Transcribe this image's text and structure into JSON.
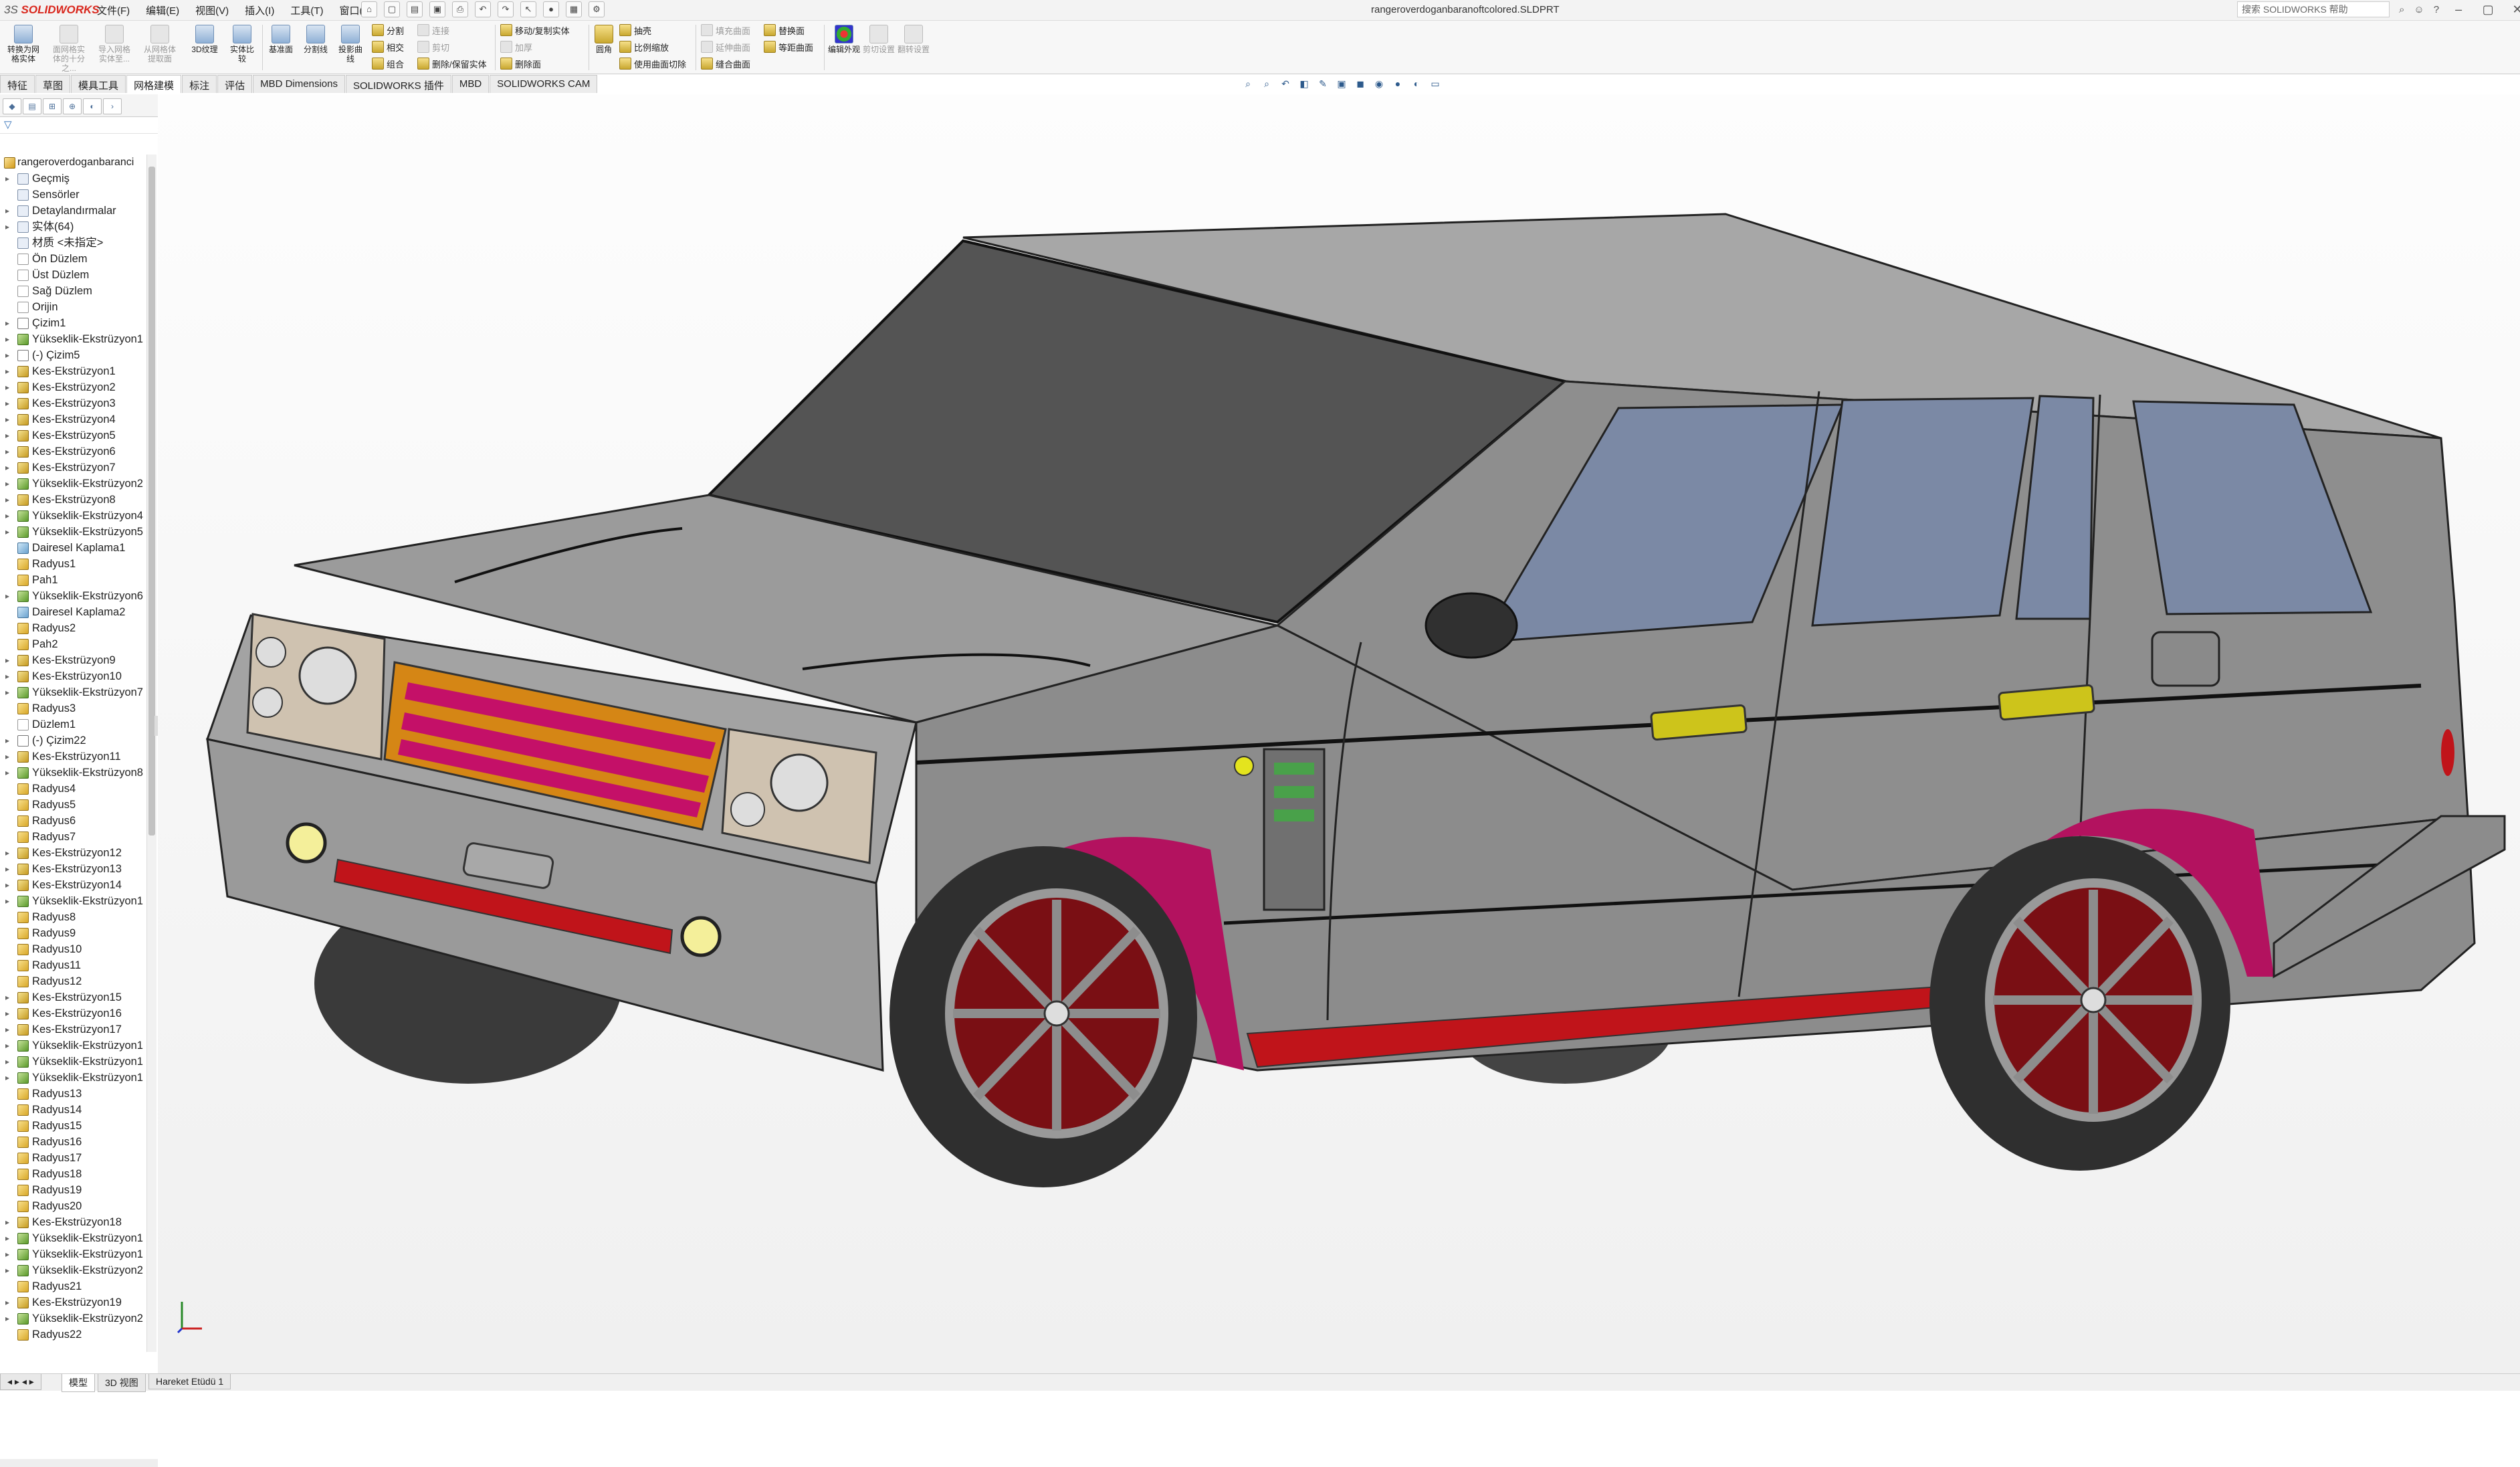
{
  "app": {
    "logo": "SOLIDWORKS",
    "logo_prefix": "3S",
    "document_title": "rangeroverdoganbaranoftcolored.SLDPRT"
  },
  "menu": [
    "文件(F)",
    "编辑(E)",
    "视图(V)",
    "插入(I)",
    "工具(T)",
    "窗口(W)"
  ],
  "help": {
    "search_placeholder": "搜索 SOLIDWORKS 帮助"
  },
  "ribbon": {
    "big": [
      {
        "label": "转换为网格实体",
        "enabled": true
      },
      {
        "label": "面网格实体的十分之...",
        "enabled": false
      },
      {
        "label": "导入网格实体至...",
        "enabled": false
      },
      {
        "label": "从网格体提取面",
        "enabled": false
      },
      {
        "label": "3D纹理",
        "enabled": true
      },
      {
        "label": "实体比较",
        "enabled": true
      },
      {
        "label": "基准面",
        "enabled": true
      },
      {
        "label": "分割线",
        "enabled": true
      },
      {
        "label": "投影曲线",
        "enabled": true
      }
    ],
    "small_a": [
      {
        "label": "分割",
        "enabled": true
      },
      {
        "label": "相交",
        "enabled": true
      },
      {
        "label": "组合",
        "enabled": true
      },
      {
        "label": "连接",
        "enabled": false
      },
      {
        "label": "剪切",
        "enabled": false
      },
      {
        "label": "删除/保留实体",
        "enabled": true
      }
    ],
    "small_b": [
      {
        "label": "移动/复制实体",
        "enabled": true
      },
      {
        "label": "加厚",
        "enabled": false
      },
      {
        "label": "删除面",
        "enabled": true
      }
    ],
    "fillet_label": "圆角",
    "small_c": [
      {
        "label": "抽壳",
        "enabled": true
      },
      {
        "label": "比例缩放",
        "enabled": true
      },
      {
        "label": "使用曲面切除",
        "enabled": true
      }
    ],
    "small_d": [
      {
        "label": "填充曲面",
        "enabled": false
      },
      {
        "label": "延伸曲面",
        "enabled": false
      },
      {
        "label": "缝合曲面",
        "enabled": true
      }
    ],
    "small_e": [
      {
        "label": "替换面",
        "enabled": true
      },
      {
        "label": "等距曲面",
        "enabled": true
      }
    ],
    "big_tail": [
      {
        "label": "编辑外观",
        "enabled": true
      },
      {
        "label": "剪切设置",
        "enabled": false
      },
      {
        "label": "翻转设置",
        "enabled": false
      }
    ]
  },
  "tabs": [
    "特征",
    "草图",
    "模具工具",
    "网格建模",
    "标注",
    "评估",
    "MBD Dimensions",
    "SOLIDWORKS 插件",
    "MBD",
    "SOLIDWORKS CAM"
  ],
  "active_tab": "网格建模",
  "tree": {
    "root": "rangeroverdoganbaranci",
    "items": [
      {
        "label": "Geçmiş",
        "icon": "history-icon",
        "arrow": true
      },
      {
        "label": "Sensörler",
        "icon": "sensor-icon",
        "arrow": false
      },
      {
        "label": "Detaylandırmalar",
        "icon": "annotation-icon",
        "arrow": true
      },
      {
        "label": "实体(64)",
        "icon": "solid-bodies-icon",
        "arrow": true
      },
      {
        "label": "材质 <未指定>",
        "icon": "material-icon",
        "arrow": false
      },
      {
        "label": "Ön Düzlem",
        "icon": "plane-icon",
        "arrow": false
      },
      {
        "label": "Üst Düzlem",
        "icon": "plane-icon",
        "arrow": false
      },
      {
        "label": "Sağ Düzlem",
        "icon": "plane-icon",
        "arrow": false
      },
      {
        "label": "Orijin",
        "icon": "origin-icon",
        "arrow": false
      },
      {
        "label": "Çizim1",
        "icon": "sketch-icon",
        "arrow": true
      },
      {
        "label": "Yükseklik-Ekstrüzyon1",
        "icon": "extrude-icon",
        "arrow": true
      },
      {
        "label": "(-) Çizim5",
        "icon": "sketch-icon",
        "arrow": true
      },
      {
        "label": "Kes-Ekstrüzyon1",
        "icon": "cut-icon",
        "arrow": true
      },
      {
        "label": "Kes-Ekstrüzyon2",
        "icon": "cut-icon",
        "arrow": true
      },
      {
        "label": "Kes-Ekstrüzyon3",
        "icon": "cut-icon",
        "arrow": true
      },
      {
        "label": "Kes-Ekstrüzyon4",
        "icon": "cut-icon",
        "arrow": true
      },
      {
        "label": "Kes-Ekstrüzyon5",
        "icon": "cut-icon",
        "arrow": true
      },
      {
        "label": "Kes-Ekstrüzyon6",
        "icon": "cut-icon",
        "arrow": true
      },
      {
        "label": "Kes-Ekstrüzyon7",
        "icon": "cut-icon",
        "arrow": true
      },
      {
        "label": "Yükseklik-Ekstrüzyon2",
        "icon": "extrude-icon",
        "arrow": true
      },
      {
        "label": "Kes-Ekstrüzyon8",
        "icon": "cut-icon",
        "arrow": true
      },
      {
        "label": "Yükseklik-Ekstrüzyon4",
        "icon": "extrude-icon",
        "arrow": true
      },
      {
        "label": "Yükseklik-Ekstrüzyon5",
        "icon": "extrude-icon",
        "arrow": true
      },
      {
        "label": "Dairesel Kaplama1",
        "icon": "pattern-icon",
        "arrow": false
      },
      {
        "label": "Radyus1",
        "icon": "fillet-icon",
        "arrow": false
      },
      {
        "label": "Pah1",
        "icon": "chamfer-icon",
        "arrow": false
      },
      {
        "label": "Yükseklik-Ekstrüzyon6",
        "icon": "extrude-icon",
        "arrow": true
      },
      {
        "label": "Dairesel Kaplama2",
        "icon": "pattern-icon",
        "arrow": false
      },
      {
        "label": "Radyus2",
        "icon": "fillet-icon",
        "arrow": false
      },
      {
        "label": "Pah2",
        "icon": "chamfer-icon",
        "arrow": false
      },
      {
        "label": "Kes-Ekstrüzyon9",
        "icon": "cut-icon",
        "arrow": true
      },
      {
        "label": "Kes-Ekstrüzyon10",
        "icon": "cut-icon",
        "arrow": true
      },
      {
        "label": "Yükseklik-Ekstrüzyon7",
        "icon": "extrude-icon",
        "arrow": true
      },
      {
        "label": "Radyus3",
        "icon": "fillet-icon",
        "arrow": false
      },
      {
        "label": "Düzlem1",
        "icon": "plane-icon",
        "arrow": false
      },
      {
        "label": "(-) Çizim22",
        "icon": "sketch-icon",
        "arrow": true
      },
      {
        "label": "Kes-Ekstrüzyon11",
        "icon": "cut-icon",
        "arrow": true
      },
      {
        "label": "Yükseklik-Ekstrüzyon8",
        "icon": "extrude-icon",
        "arrow": true
      },
      {
        "label": "Radyus4",
        "icon": "fillet-icon",
        "arrow": false
      },
      {
        "label": "Radyus5",
        "icon": "fillet-icon",
        "arrow": false
      },
      {
        "label": "Radyus6",
        "icon": "fillet-icon",
        "arrow": false
      },
      {
        "label": "Radyus7",
        "icon": "fillet-icon",
        "arrow": false
      },
      {
        "label": "Kes-Ekstrüzyon12",
        "icon": "cut-icon",
        "arrow": true
      },
      {
        "label": "Kes-Ekstrüzyon13",
        "icon": "cut-icon",
        "arrow": true
      },
      {
        "label": "Kes-Ekstrüzyon14",
        "icon": "cut-icon",
        "arrow": true
      },
      {
        "label": "Yükseklik-Ekstrüzyon1",
        "icon": "extrude-icon",
        "arrow": true
      },
      {
        "label": "Radyus8",
        "icon": "fillet-icon",
        "arrow": false
      },
      {
        "label": "Radyus9",
        "icon": "fillet-icon",
        "arrow": false
      },
      {
        "label": "Radyus10",
        "icon": "fillet-icon",
        "arrow": false
      },
      {
        "label": "Radyus11",
        "icon": "fillet-icon",
        "arrow": false
      },
      {
        "label": "Radyus12",
        "icon": "fillet-icon",
        "arrow": false
      },
      {
        "label": "Kes-Ekstrüzyon15",
        "icon": "cut-icon",
        "arrow": true
      },
      {
        "label": "Kes-Ekstrüzyon16",
        "icon": "cut-icon",
        "arrow": true
      },
      {
        "label": "Kes-Ekstrüzyon17",
        "icon": "cut-icon",
        "arrow": true
      },
      {
        "label": "Yükseklik-Ekstrüzyon1",
        "icon": "extrude-icon",
        "arrow": true
      },
      {
        "label": "Yükseklik-Ekstrüzyon1",
        "icon": "extrude-icon",
        "arrow": true
      },
      {
        "label": "Yükseklik-Ekstrüzyon1",
        "icon": "extrude-icon",
        "arrow": true
      },
      {
        "label": "Radyus13",
        "icon": "fillet-icon",
        "arrow": false
      },
      {
        "label": "Radyus14",
        "icon": "fillet-icon",
        "arrow": false
      },
      {
        "label": "Radyus15",
        "icon": "fillet-icon",
        "arrow": false
      },
      {
        "label": "Radyus16",
        "icon": "fillet-icon",
        "arrow": false
      },
      {
        "label": "Radyus17",
        "icon": "fillet-icon",
        "arrow": false
      },
      {
        "label": "Radyus18",
        "icon": "fillet-icon",
        "arrow": false
      },
      {
        "label": "Radyus19",
        "icon": "fillet-icon",
        "arrow": false
      },
      {
        "label": "Radyus20",
        "icon": "fillet-icon",
        "arrow": false
      },
      {
        "label": "Kes-Ekstrüzyon18",
        "icon": "cut-icon",
        "arrow": true
      },
      {
        "label": "Yükseklik-Ekstrüzyon1",
        "icon": "extrude-icon",
        "arrow": true
      },
      {
        "label": "Yükseklik-Ekstrüzyon1",
        "icon": "extrude-icon",
        "arrow": true
      },
      {
        "label": "Yükseklik-Ekstrüzyon2",
        "icon": "extrude-icon",
        "arrow": true
      },
      {
        "label": "Radyus21",
        "icon": "fillet-icon",
        "arrow": false
      },
      {
        "label": "Kes-Ekstrüzyon19",
        "icon": "cut-icon",
        "arrow": true
      },
      {
        "label": "Yükseklik-Ekstrüzyon2",
        "icon": "extrude-icon",
        "arrow": true
      },
      {
        "label": "Radyus22",
        "icon": "fillet-icon",
        "arrow": false
      }
    ]
  },
  "bottom_tabs": [
    "模型",
    "3D 视图",
    "Hareket Etüdü 1"
  ],
  "active_bottom_tab": "模型",
  "colors": {
    "body": "#8c8c8c",
    "accent_magenta": "#b3125f",
    "red": "#c0141a",
    "yellow": "#d8cc1a",
    "glass": "#7c8aa6"
  }
}
